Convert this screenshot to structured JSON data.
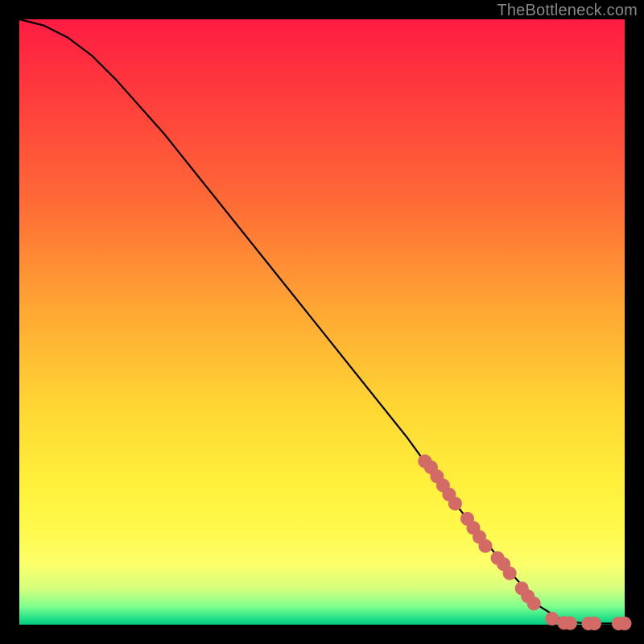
{
  "attribution": "TheBottleneck.com",
  "colors": {
    "curve": "#000000",
    "marker_fill": "#d36a66",
    "marker_stroke": "#d36a66",
    "frame_bg": "#000000"
  },
  "chart_data": {
    "type": "line",
    "title": "",
    "xlabel": "",
    "ylabel": "",
    "xlim": [
      0,
      100
    ],
    "ylim": [
      0,
      100
    ],
    "grid": false,
    "curve": [
      {
        "x": 0,
        "y": 100
      },
      {
        "x": 4,
        "y": 99
      },
      {
        "x": 8,
        "y": 97
      },
      {
        "x": 12,
        "y": 94
      },
      {
        "x": 16,
        "y": 90
      },
      {
        "x": 24,
        "y": 81
      },
      {
        "x": 32,
        "y": 71
      },
      {
        "x": 40,
        "y": 61
      },
      {
        "x": 48,
        "y": 51
      },
      {
        "x": 56,
        "y": 41
      },
      {
        "x": 64,
        "y": 31
      },
      {
        "x": 72,
        "y": 20
      },
      {
        "x": 80,
        "y": 10
      },
      {
        "x": 86,
        "y": 3
      },
      {
        "x": 90,
        "y": 0.5
      },
      {
        "x": 94,
        "y": 0.2
      },
      {
        "x": 100,
        "y": 0.2
      }
    ],
    "markers": [
      {
        "x": 67,
        "y": 27
      },
      {
        "x": 68,
        "y": 26
      },
      {
        "x": 69,
        "y": 24.5
      },
      {
        "x": 70,
        "y": 23
      },
      {
        "x": 71,
        "y": 21.5
      },
      {
        "x": 72,
        "y": 20
      },
      {
        "x": 74,
        "y": 17.5
      },
      {
        "x": 75,
        "y": 16
      },
      {
        "x": 76,
        "y": 14.5
      },
      {
        "x": 77,
        "y": 13
      },
      {
        "x": 79,
        "y": 11
      },
      {
        "x": 80,
        "y": 10
      },
      {
        "x": 81,
        "y": 8.5
      },
      {
        "x": 83,
        "y": 6
      },
      {
        "x": 84,
        "y": 4.7
      },
      {
        "x": 85,
        "y": 3.5
      },
      {
        "x": 88,
        "y": 1
      },
      {
        "x": 90,
        "y": 0.3
      },
      {
        "x": 91,
        "y": 0.25
      },
      {
        "x": 94,
        "y": 0.2
      },
      {
        "x": 95,
        "y": 0.2
      },
      {
        "x": 99,
        "y": 0.2
      },
      {
        "x": 100,
        "y": 0.2
      }
    ]
  }
}
